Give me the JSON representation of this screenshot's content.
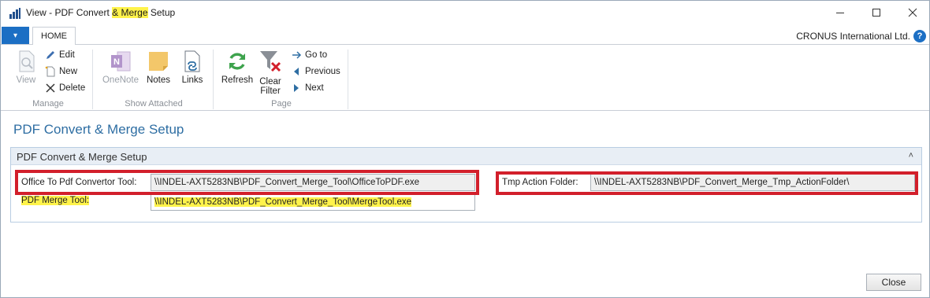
{
  "window": {
    "title_prefix": "View - PDF Convert ",
    "title_redacted": "& Merge",
    "title_suffix": " Setup"
  },
  "ribbon": {
    "app_menu_glyph": "▾",
    "tab_home": "HOME",
    "company": "CRONUS International Ltd.",
    "help_glyph": "?",
    "groups": {
      "manage": {
        "label": "Manage",
        "view": "View",
        "edit": "Edit",
        "new": "New",
        "delete": "Delete"
      },
      "show_attached": {
        "label": "Show Attached",
        "onenote": "OneNote",
        "notes": "Notes",
        "links": "Links"
      },
      "page": {
        "label": "Page",
        "refresh": "Refresh",
        "clear_filter_1": "Clear",
        "clear_filter_2": "Filter",
        "goto": "Go to",
        "previous": "Previous",
        "next": "Next"
      }
    },
    "icons": [
      "view-icon",
      "edit-icon",
      "new-icon",
      "delete-icon",
      "onenote-icon",
      "notes-icon",
      "links-icon",
      "refresh-icon",
      "clear-filter-icon",
      "goto-icon",
      "previous-icon",
      "next-icon"
    ]
  },
  "page": {
    "title": "PDF Convert & Merge Setup",
    "fasttab": {
      "title": "PDF Convert & Merge Setup",
      "collapse_glyph": "˄"
    },
    "fields": {
      "office_tool": {
        "label": "Office To Pdf Convertor Tool:",
        "value": "\\\\INDEL-AXT5283NB\\PDF_Convert_Merge_Tool\\OfficeToPDF.exe"
      },
      "merge_tool": {
        "label": "PDF Merge Tool:",
        "value": "\\\\INDEL-AXT5283NB\\PDF_Convert_Merge_Tool\\MergeTool.exe"
      },
      "tmp_folder": {
        "label": "Tmp Action Folder:",
        "value": "\\\\INDEL-AXT5283NB\\PDF_Convert_Merge_Tmp_ActionFolder\\"
      }
    },
    "close_button": "Close"
  },
  "colors": {
    "accent": "#1c6fc4",
    "page_title": "#2e6ea3",
    "highlight_box": "#d21f2b",
    "redaction": "#fff34a"
  }
}
